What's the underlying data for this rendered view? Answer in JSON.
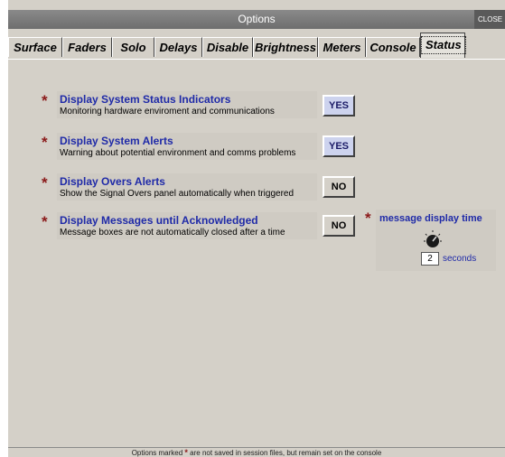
{
  "window": {
    "title": "Options",
    "close_label": "CLOSE"
  },
  "tabs": [
    {
      "label": "Surface"
    },
    {
      "label": "Faders"
    },
    {
      "label": "Solo"
    },
    {
      "label": "Delays"
    },
    {
      "label": "Disable"
    },
    {
      "label": "Brightness"
    },
    {
      "label": "Meters"
    },
    {
      "label": "Console"
    },
    {
      "label": "Status",
      "active": true
    }
  ],
  "options": [
    {
      "title": "Display System Status Indicators",
      "desc": "Monitoring hardware enviroment and communications",
      "value": "YES"
    },
    {
      "title": "Display System Alerts",
      "desc": "Warning about potential environment and comms problems",
      "value": "YES"
    },
    {
      "title": "Display Overs Alerts",
      "desc": "Show the Signal Overs panel automatically when triggered",
      "value": "NO"
    },
    {
      "title": "Display Messages until Acknowledged",
      "desc": "Message boxes are not automatically closed after a time",
      "value": "NO"
    }
  ],
  "message_display": {
    "label": "message display time",
    "value": "2",
    "unit": "seconds"
  },
  "footer": {
    "before": "Options marked",
    "star": "*",
    "after": "are not saved in session files, but remain set on the console"
  },
  "colors": {
    "accent_text": "#1f2aa8",
    "star": "#8b1a1a",
    "yes_bg": "#cdd3ee"
  }
}
